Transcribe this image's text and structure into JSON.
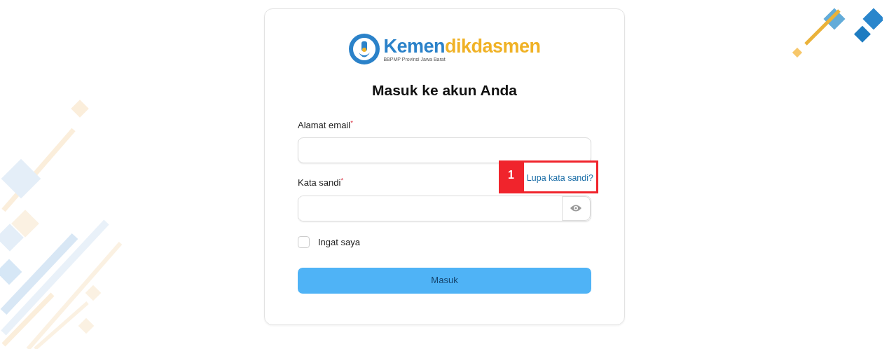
{
  "logo": {
    "wordmark_primary": "Kemen",
    "wordmark_secondary": "dikdasmen",
    "subtitle": "BBPMP Provinsi Jawa Barat"
  },
  "title": "Masuk ke akun Anda",
  "fields": [
    {
      "kind": "email",
      "label": "Alamat email",
      "required_mark": "*"
    },
    {
      "kind": "password",
      "label": "Kata sandi",
      "required_mark": "*",
      "link": "Lupa kata sandi?",
      "annotation": "1"
    }
  ],
  "remember": {
    "label": "Ingat saya",
    "checked": false
  },
  "submit": "Masuk"
}
